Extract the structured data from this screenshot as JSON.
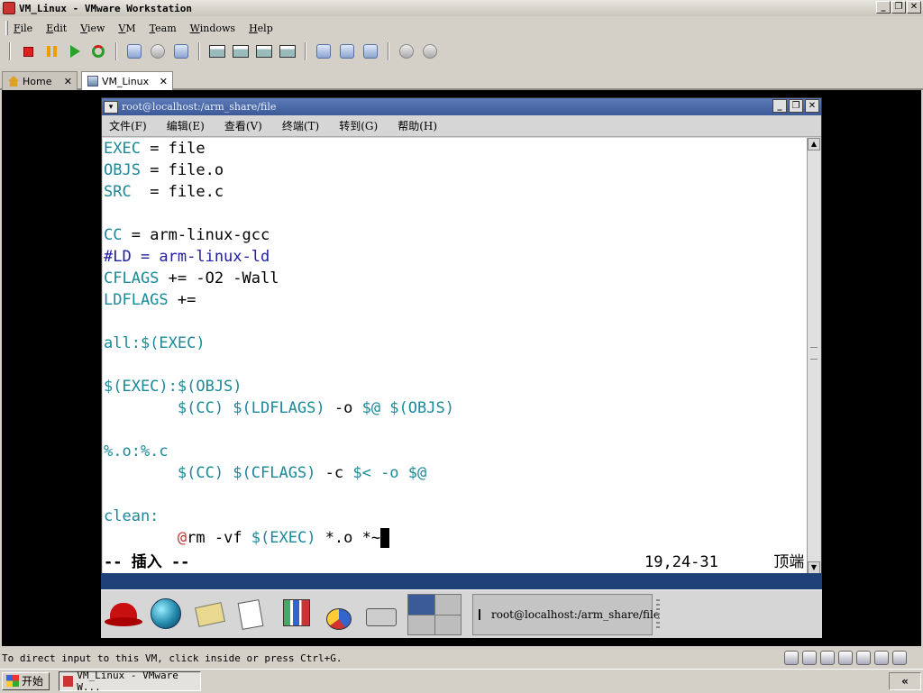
{
  "window": {
    "title": "VM_Linux - VMware Workstation"
  },
  "menubar": {
    "items": [
      {
        "label": "File",
        "mnemonic": "F",
        "rest": "ile"
      },
      {
        "label": "Edit",
        "mnemonic": "E",
        "rest": "dit"
      },
      {
        "label": "View",
        "mnemonic": "V",
        "rest": "iew"
      },
      {
        "label": "VM",
        "mnemonic": "V",
        "rest": "M"
      },
      {
        "label": "Team",
        "mnemonic": "T",
        "rest": "eam"
      },
      {
        "label": "Windows",
        "mnemonic": "W",
        "rest": "indows"
      },
      {
        "label": "Help",
        "mnemonic": "H",
        "rest": "elp"
      }
    ]
  },
  "tabs": [
    {
      "label": "Home",
      "icon": "home-icon",
      "active": false
    },
    {
      "label": "VM_Linux",
      "icon": "vm-icon",
      "active": true
    }
  ],
  "terminal": {
    "title": "root@localhost:/arm_share/file",
    "menu": [
      "文件(F)",
      "编辑(E)",
      "查看(V)",
      "终端(T)",
      "转到(G)",
      "帮助(H)"
    ],
    "lines": [
      {
        "key": "EXEC",
        "rest": " = file"
      },
      {
        "key": "OBJS",
        "rest": " = file.o"
      },
      {
        "key": "SRC",
        "rest": "  = file.c"
      },
      {
        "key": "",
        "rest": ""
      },
      {
        "key": "CC",
        "rest": " = arm-linux-gcc"
      },
      {
        "key": "#LD = arm-linux-ld",
        "rest": ""
      },
      {
        "key": "CFLAGS",
        "rest": " += -O2 -Wall"
      },
      {
        "key": "LDFLAGS",
        "rest": " +="
      },
      {
        "key": "",
        "rest": ""
      },
      {
        "key": "all:$(EXEC)",
        "rest": ""
      },
      {
        "key": "",
        "rest": ""
      },
      {
        "key": "$(EXEC):$(OBJS)",
        "rest": ""
      },
      {
        "key": "        $(CC) $(LDFLAGS)",
        "rest": " -o ",
        "tail": "$@ $(OBJS)"
      },
      {
        "key": "",
        "rest": ""
      },
      {
        "key": "%.o:%.c",
        "rest": ""
      },
      {
        "key": "        $(CC) $(CFLAGS)",
        "rest": " -c ",
        "tail": "$< -o $@"
      },
      {
        "key": "",
        "rest": ""
      },
      {
        "key": "clean:",
        "rest": ""
      },
      {
        "key": "",
        "rest": ""
      }
    ],
    "last_line": {
      "indent": "        ",
      "at": "@",
      "cmd": "rm -vf ",
      "var": "$(EXEC)",
      "end": " *.o *~"
    },
    "status_mode": "-- 插入 --",
    "status_pos": "19,24-31      顶端"
  },
  "guest_panel": {
    "task_label": "root@localhost:/arm_share/file"
  },
  "vm_status": {
    "message": "To direct input to this VM, click inside or press Ctrl+G."
  },
  "host_taskbar": {
    "start_label": "开始",
    "task_label": "VM_Linux - VMware W...",
    "tray_label": "«"
  }
}
